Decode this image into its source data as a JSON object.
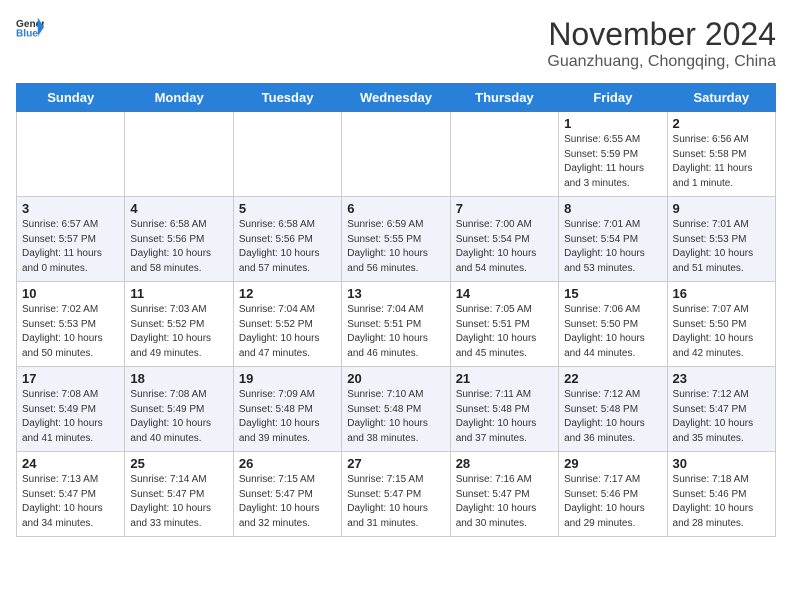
{
  "header": {
    "logo_general": "General",
    "logo_blue": "Blue",
    "month_title": "November 2024",
    "location": "Guanzhuang, Chongqing, China"
  },
  "weekdays": [
    "Sunday",
    "Monday",
    "Tuesday",
    "Wednesday",
    "Thursday",
    "Friday",
    "Saturday"
  ],
  "weeks": [
    {
      "alt": false,
      "days": [
        {
          "num": "",
          "detail": ""
        },
        {
          "num": "",
          "detail": ""
        },
        {
          "num": "",
          "detail": ""
        },
        {
          "num": "",
          "detail": ""
        },
        {
          "num": "",
          "detail": ""
        },
        {
          "num": "1",
          "detail": "Sunrise: 6:55 AM\nSunset: 5:59 PM\nDaylight: 11 hours\nand 3 minutes."
        },
        {
          "num": "2",
          "detail": "Sunrise: 6:56 AM\nSunset: 5:58 PM\nDaylight: 11 hours\nand 1 minute."
        }
      ]
    },
    {
      "alt": true,
      "days": [
        {
          "num": "3",
          "detail": "Sunrise: 6:57 AM\nSunset: 5:57 PM\nDaylight: 11 hours\nand 0 minutes."
        },
        {
          "num": "4",
          "detail": "Sunrise: 6:58 AM\nSunset: 5:56 PM\nDaylight: 10 hours\nand 58 minutes."
        },
        {
          "num": "5",
          "detail": "Sunrise: 6:58 AM\nSunset: 5:56 PM\nDaylight: 10 hours\nand 57 minutes."
        },
        {
          "num": "6",
          "detail": "Sunrise: 6:59 AM\nSunset: 5:55 PM\nDaylight: 10 hours\nand 56 minutes."
        },
        {
          "num": "7",
          "detail": "Sunrise: 7:00 AM\nSunset: 5:54 PM\nDaylight: 10 hours\nand 54 minutes."
        },
        {
          "num": "8",
          "detail": "Sunrise: 7:01 AM\nSunset: 5:54 PM\nDaylight: 10 hours\nand 53 minutes."
        },
        {
          "num": "9",
          "detail": "Sunrise: 7:01 AM\nSunset: 5:53 PM\nDaylight: 10 hours\nand 51 minutes."
        }
      ]
    },
    {
      "alt": false,
      "days": [
        {
          "num": "10",
          "detail": "Sunrise: 7:02 AM\nSunset: 5:53 PM\nDaylight: 10 hours\nand 50 minutes."
        },
        {
          "num": "11",
          "detail": "Sunrise: 7:03 AM\nSunset: 5:52 PM\nDaylight: 10 hours\nand 49 minutes."
        },
        {
          "num": "12",
          "detail": "Sunrise: 7:04 AM\nSunset: 5:52 PM\nDaylight: 10 hours\nand 47 minutes."
        },
        {
          "num": "13",
          "detail": "Sunrise: 7:04 AM\nSunset: 5:51 PM\nDaylight: 10 hours\nand 46 minutes."
        },
        {
          "num": "14",
          "detail": "Sunrise: 7:05 AM\nSunset: 5:51 PM\nDaylight: 10 hours\nand 45 minutes."
        },
        {
          "num": "15",
          "detail": "Sunrise: 7:06 AM\nSunset: 5:50 PM\nDaylight: 10 hours\nand 44 minutes."
        },
        {
          "num": "16",
          "detail": "Sunrise: 7:07 AM\nSunset: 5:50 PM\nDaylight: 10 hours\nand 42 minutes."
        }
      ]
    },
    {
      "alt": true,
      "days": [
        {
          "num": "17",
          "detail": "Sunrise: 7:08 AM\nSunset: 5:49 PM\nDaylight: 10 hours\nand 41 minutes."
        },
        {
          "num": "18",
          "detail": "Sunrise: 7:08 AM\nSunset: 5:49 PM\nDaylight: 10 hours\nand 40 minutes."
        },
        {
          "num": "19",
          "detail": "Sunrise: 7:09 AM\nSunset: 5:48 PM\nDaylight: 10 hours\nand 39 minutes."
        },
        {
          "num": "20",
          "detail": "Sunrise: 7:10 AM\nSunset: 5:48 PM\nDaylight: 10 hours\nand 38 minutes."
        },
        {
          "num": "21",
          "detail": "Sunrise: 7:11 AM\nSunset: 5:48 PM\nDaylight: 10 hours\nand 37 minutes."
        },
        {
          "num": "22",
          "detail": "Sunrise: 7:12 AM\nSunset: 5:48 PM\nDaylight: 10 hours\nand 36 minutes."
        },
        {
          "num": "23",
          "detail": "Sunrise: 7:12 AM\nSunset: 5:47 PM\nDaylight: 10 hours\nand 35 minutes."
        }
      ]
    },
    {
      "alt": false,
      "days": [
        {
          "num": "24",
          "detail": "Sunrise: 7:13 AM\nSunset: 5:47 PM\nDaylight: 10 hours\nand 34 minutes."
        },
        {
          "num": "25",
          "detail": "Sunrise: 7:14 AM\nSunset: 5:47 PM\nDaylight: 10 hours\nand 33 minutes."
        },
        {
          "num": "26",
          "detail": "Sunrise: 7:15 AM\nSunset: 5:47 PM\nDaylight: 10 hours\nand 32 minutes."
        },
        {
          "num": "27",
          "detail": "Sunrise: 7:15 AM\nSunset: 5:47 PM\nDaylight: 10 hours\nand 31 minutes."
        },
        {
          "num": "28",
          "detail": "Sunrise: 7:16 AM\nSunset: 5:47 PM\nDaylight: 10 hours\nand 30 minutes."
        },
        {
          "num": "29",
          "detail": "Sunrise: 7:17 AM\nSunset: 5:46 PM\nDaylight: 10 hours\nand 29 minutes."
        },
        {
          "num": "30",
          "detail": "Sunrise: 7:18 AM\nSunset: 5:46 PM\nDaylight: 10 hours\nand 28 minutes."
        }
      ]
    }
  ]
}
